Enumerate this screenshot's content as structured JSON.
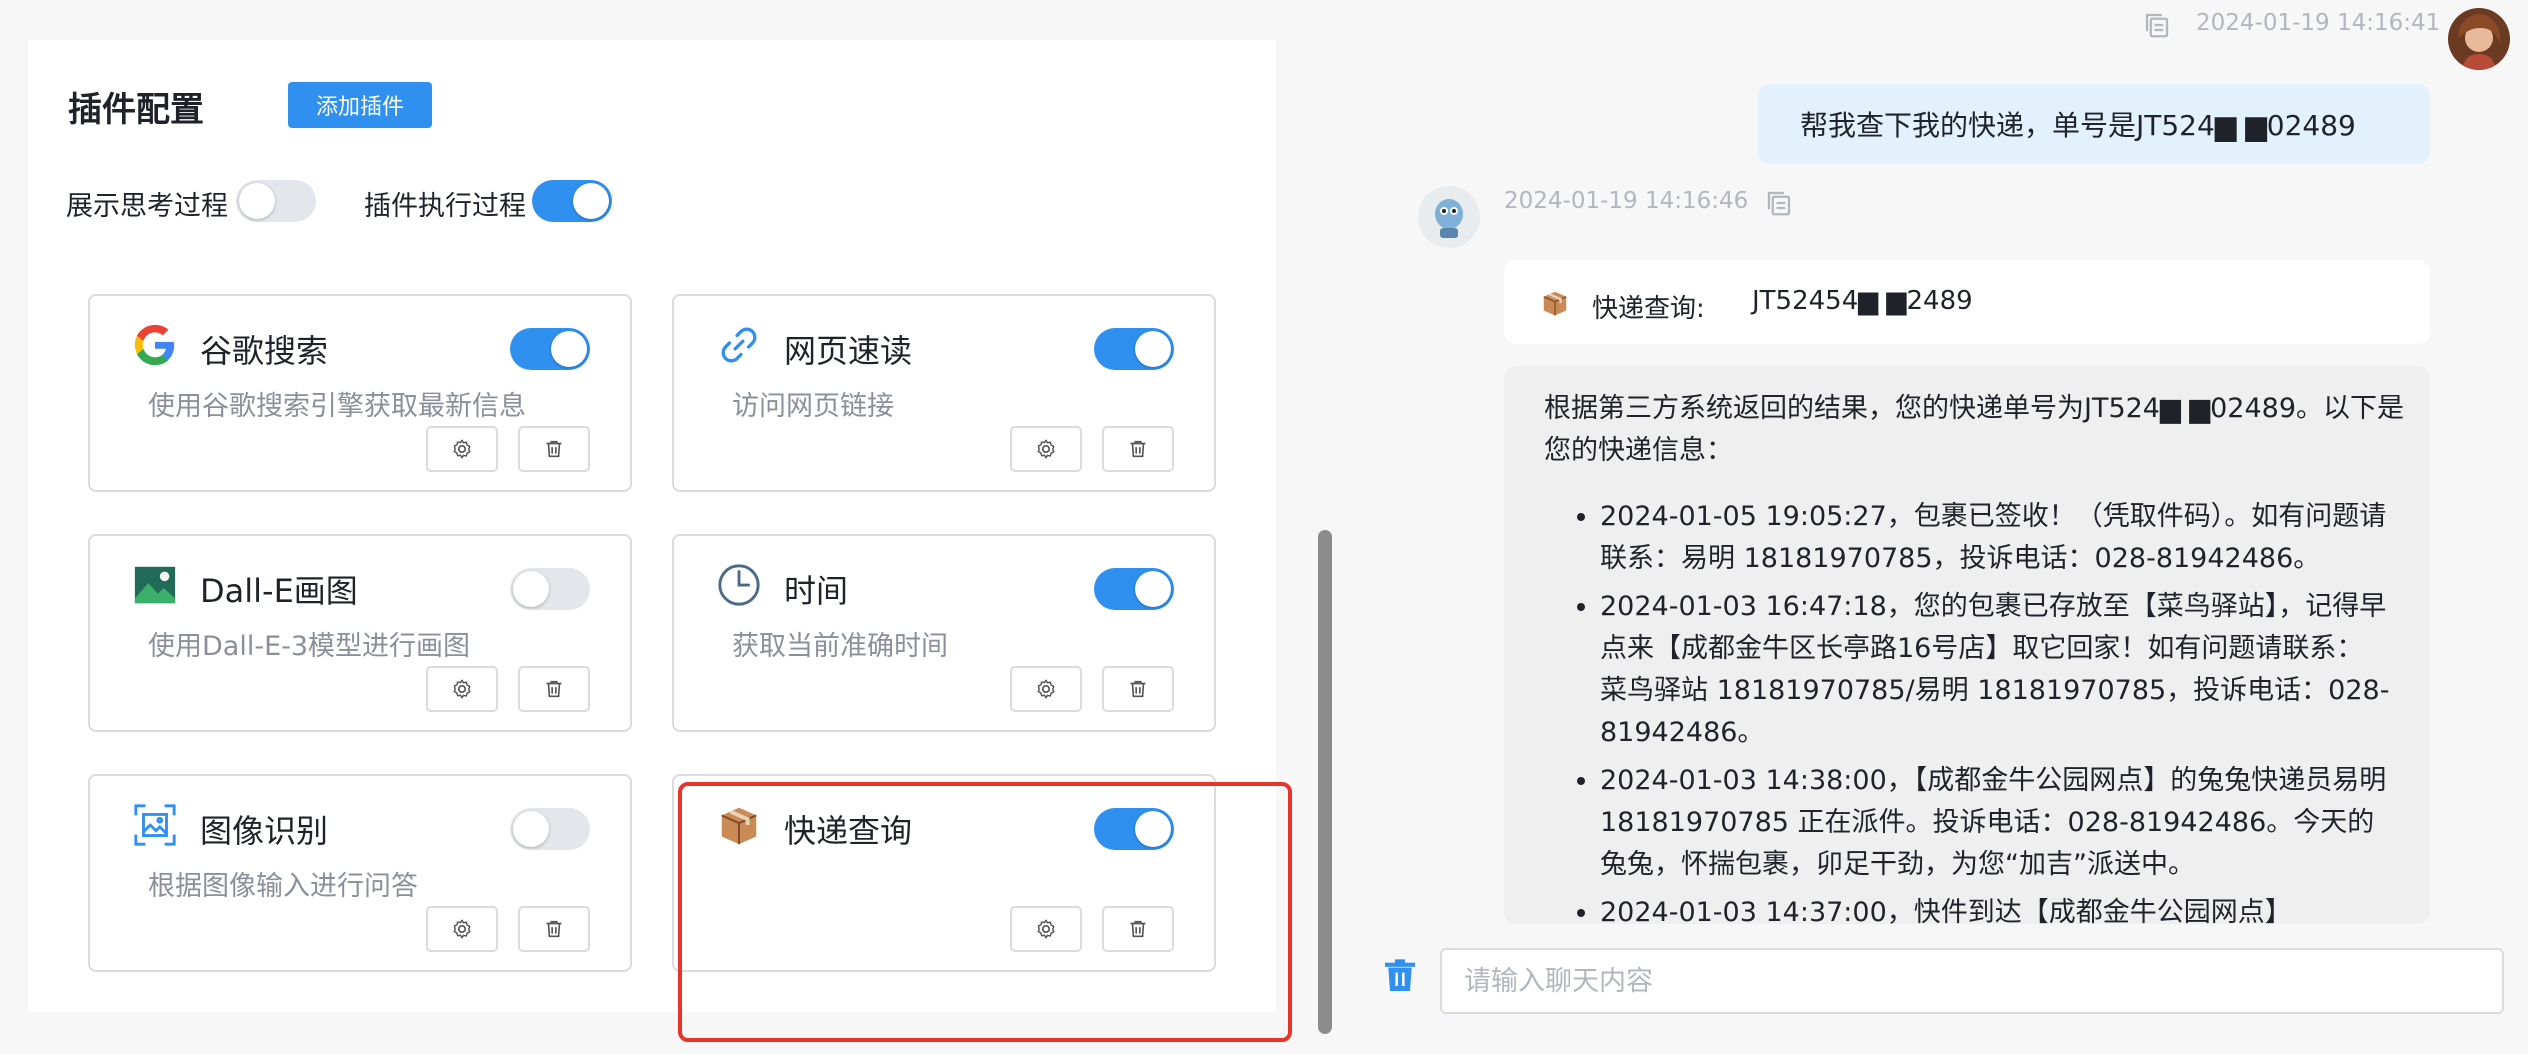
{
  "plugin_panel": {
    "title": "插件配置",
    "add_button": "添加插件",
    "show_thinking_label": "展示思考过程",
    "show_thinking_on": false,
    "plugin_exec_label": "插件执行过程",
    "plugin_exec_on": true
  },
  "plugins": [
    {
      "name": "谷歌搜索",
      "desc": "使用谷歌搜索引擎获取最新信息",
      "enabled": true,
      "icon": "google-icon"
    },
    {
      "name": "网页速读",
      "desc": "访问网页链接",
      "enabled": true,
      "icon": "link-icon"
    },
    {
      "name": "Dall-E画图",
      "desc": "使用Dall-E-3模型进行画图",
      "enabled": false,
      "icon": "image-icon"
    },
    {
      "name": "时间",
      "desc": "获取当前准确时间",
      "enabled": true,
      "icon": "clock-icon"
    },
    {
      "name": "图像识别",
      "desc": "根据图像输入进行问答",
      "enabled": false,
      "icon": "image-scan-icon"
    },
    {
      "name": "快递查询",
      "desc": "",
      "enabled": true,
      "icon": "package-icon"
    }
  ],
  "chat": {
    "user_timestamp": "2024-01-19 14:16:41",
    "user_message": "帮我查下我的快递，单号是JT524▆ ▆02489",
    "bot_timestamp": "2024-01-19 14:16:46",
    "tool_label": "快递查询:",
    "tool_value": "JT52454▆ ▆2489",
    "answer_intro": "根据第三方系统返回的结果，您的快递单号为JT524▆ ▆02489。以下是您的快递信息：",
    "answer_items": [
      "2024-01-05 19:05:27，包裹已签收！（凭取件码）。如有问题请联系：易明 18181970785，投诉电话：028-81942486。",
      "2024-01-03 16:47:18，您的包裹已存放至【菜鸟驿站】，记得早点来【成都金牛区长亭路16号店】取它回家！如有问题请联系：菜鸟驿站 18181970785/易明 18181970785，投诉电话：028-81942486。",
      "2024-01-03 14:38:00，【成都金牛公园网点】的兔兔快递员易明 18181970785 正在派件。投诉电话：028-81942486。今天的兔兔，怀揣包裹，卯足干劲，为您“加吉”派送中。",
      "2024-01-03 14:37:00，快件到达【成都金牛公园网点】"
    ],
    "input_placeholder": "请输入聊天内容"
  },
  "colors": {
    "accent": "#2f90f0",
    "highlight": "#e8352b"
  }
}
